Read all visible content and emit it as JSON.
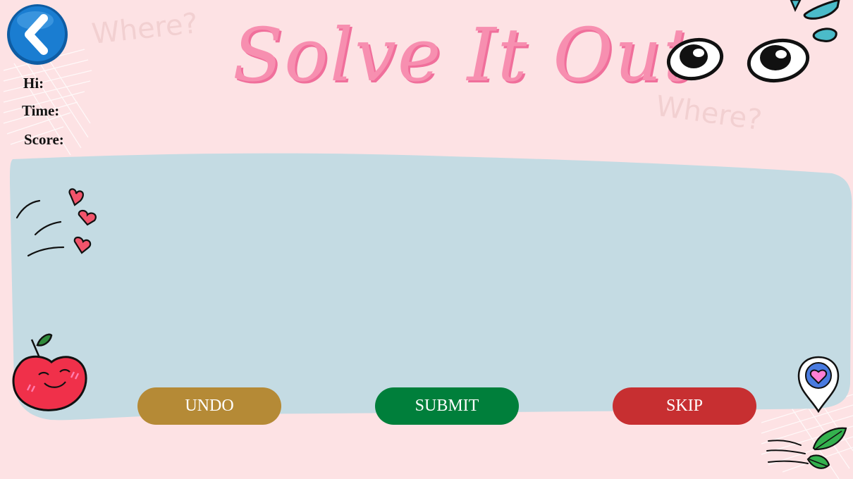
{
  "title": "Solve It Out",
  "watermark_text": "Where?",
  "info": {
    "hi_label": "Hi:",
    "time_label": "Time:",
    "score_label": "Score:"
  },
  "buttons": {
    "undo": {
      "label": "UNDO",
      "color": "#b58a36"
    },
    "submit": {
      "label": "SUBMIT",
      "color": "#007f3b"
    },
    "skip": {
      "label": "SKIP",
      "color": "#c72f31"
    }
  },
  "colors": {
    "background": "#fde2e4",
    "board": "#c4dbe3",
    "title": "#f78fb0",
    "back_button": "#1a7dd1"
  },
  "icons": [
    "back-arrow-icon",
    "eyes-icon",
    "water-drops-icon",
    "hearts-icon",
    "apple-icon",
    "location-pin-heart-icon",
    "leaves-icon"
  ]
}
